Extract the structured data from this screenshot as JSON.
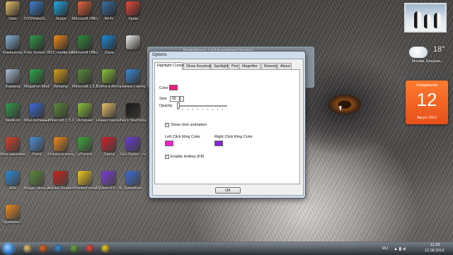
{
  "desktop_icons": [
    {
      "name": "desktop-icon-user",
      "icon": "folder-user-icon",
      "label": "User",
      "color": "#e8c26a"
    },
    {
      "name": "desktop-icon-dvdvideosoft",
      "icon": "dvdvideosoft-icon",
      "label": "DVDVideoS... Free Studio",
      "color": "#3a7fd0"
    },
    {
      "name": "desktop-icon-skype",
      "icon": "skype-icon",
      "label": "Skype",
      "color": "#1fa8e8"
    },
    {
      "name": "desktop-icon-ms-office-po",
      "icon": "office-powerpoint-icon",
      "label": "Microsoft Office Po...",
      "color": "#e8643a"
    },
    {
      "name": "desktop-icon-wifi",
      "icon": "wifi-icon",
      "label": "Wi-Fi",
      "color": "#3a6ea8"
    },
    {
      "name": "desktop-icon-chrome",
      "icon": "chrome-icon",
      "label": "Хром",
      "color": "#e84a3a"
    },
    {
      "name": "desktop-icon-computer",
      "icon": "computer-icon",
      "label": "Компьютер",
      "color": "#8ab4d8"
    },
    {
      "name": "desktop-icon-free-screen-video",
      "icon": "free-screen-video-icon",
      "label": "Free Screen Video Re...",
      "color": "#2f9a4a"
    },
    {
      "name": "desktop-icon-vlc",
      "icon": "vlc-icon",
      "label": "VLC media player",
      "color": "#f08a1a"
    },
    {
      "name": "desktop-icon-ms-office",
      "icon": "office-excel-icon",
      "label": "Microsoft Office",
      "color": "#2f8a3a"
    },
    {
      "name": "desktop-icon-zona",
      "icon": "zona-icon",
      "label": "Zona",
      "color": "#1a8ad8"
    },
    {
      "name": "desktop-icon-doc",
      "icon": "document-icon",
      "label": "",
      "color": "#f0f0f0"
    },
    {
      "name": "desktop-icon-recycle",
      "icon": "recycle-bin-icon",
      "label": "Корзина",
      "color": "#a8c0d8"
    },
    {
      "name": "desktop-icon-megafon",
      "icon": "megafon-icon",
      "label": "MegaFon Modem",
      "color": "#2fa84a"
    },
    {
      "name": "desktop-icon-winamp",
      "icon": "winamp-icon",
      "label": "Winamp",
      "color": "#d8a01a"
    },
    {
      "name": "desktop-icon-minecraft-1",
      "icon": "minecraft-icon",
      "label": "Minecraft 1.5.2 - Mine...",
      "color": "#5a8a3a"
    },
    {
      "name": "desktop-icon-vk",
      "icon": "vk-login-icon",
      "label": "Войти в Интернет",
      "color": "#8ac43a"
    },
    {
      "name": "desktop-icon-download",
      "icon": "download-icon",
      "label": "скачка с интернета...",
      "color": "#3a8ad8"
    },
    {
      "name": "desktop-icon-multifon",
      "icon": "multifon-icon",
      "label": "MultiFon",
      "color": "#2f9a4a"
    },
    {
      "name": "desktop-icon-my-games",
      "icon": "my-games-icon",
      "label": "Мои любимые...",
      "color": "#3a6ad8"
    },
    {
      "name": "desktop-icon-minecraft-2",
      "icon": "minecraft-icon",
      "label": "Minecraft 1.5.2 - Mine...",
      "color": "#5a8a3a"
    },
    {
      "name": "desktop-icon-internet",
      "icon": "internet-icon",
      "label": "Интернет",
      "color": "#8ac43a"
    },
    {
      "name": "desktop-icon-new-folder",
      "icon": "folder-icon",
      "label": "Новая сжатая ...",
      "color": "#e8c26a"
    },
    {
      "name": "desktop-icon-nero",
      "icon": "nero-icon",
      "label": "Nero StartSmart",
      "color": "#1a1a1a"
    },
    {
      "name": "desktop-icon-my-stickers",
      "icon": "stickers-icon",
      "label": "Мои наклейки",
      "color": "#d8402a"
    },
    {
      "name": "desktop-icon-paint",
      "icon": "paint-icon",
      "label": "Paint",
      "color": "#4a90d8"
    },
    {
      "name": "desktop-icon-mail-search",
      "icon": "mail-search-icon",
      "label": "Искать в интернете",
      "color": "#f08a1a"
    },
    {
      "name": "desktop-icon-utorrent",
      "icon": "utorrent-icon",
      "label": "µTorrent",
      "color": "#3aa83a"
    },
    {
      "name": "desktop-icon-opera",
      "icon": "opera-icon",
      "label": "Opera",
      "color": "#d8202a"
    },
    {
      "name": "desktop-icon-get-styles",
      "icon": "get-styles-icon",
      "label": "Get-Styles - темы для ...",
      "color": "#6a3ad8"
    },
    {
      "name": "desktop-icon-9dx",
      "icon": "dx-icon",
      "label": "9Dx",
      "color": "#2a8ad8"
    },
    {
      "name": "desktop-icon-mods",
      "icon": "mods-icon",
      "label": "Моды, читы для Minecraft",
      "color": "#5a8a3a"
    },
    {
      "name": "desktop-icon-adobe-reader",
      "icon": "adobe-reader-icon",
      "label": "Adobe Reader X",
      "color": "#c8201a"
    },
    {
      "name": "desktop-icon-pointerfocus",
      "icon": "pointerfocus-icon",
      "label": "PointerFocus",
      "color": "#f0c81a"
    },
    {
      "name": "desktop-icon-djview",
      "icon": "djview-icon",
      "label": "DjView-0.5 - Ярлык",
      "color": "#7a3ad8"
    },
    {
      "name": "desktop-icon-speedfan",
      "icon": "speedfan-icon",
      "label": "SpeedFan",
      "color": "#3a6ad8"
    },
    {
      "name": "desktop-icon-odnoklassniki",
      "icon": "odnoklassniki-icon",
      "label": "Одноклас...",
      "color": "#f08a1a"
    }
  ],
  "gadgets": {
    "weather": {
      "temp": "18°",
      "city": "Москва, Бачургаз..."
    },
    "calendar": {
      "weekday": "понедельник",
      "day": "12",
      "month": "Август 2013"
    }
  },
  "background_window": {
    "title": "PointerFocus 1.4 (Unregistered Version)"
  },
  "dialog": {
    "title": "Options",
    "tabs": [
      "Highlight Cursor",
      "Show Keystrokes",
      "Spotlight",
      "Pen",
      "Magnifier",
      "Remote",
      "About"
    ],
    "active_tab": 0,
    "color_label": "Color",
    "color_value": "#e8207a",
    "size_label": "Size",
    "size_value": "65",
    "opacity_label": "Opacity",
    "opacity_level": 0.0,
    "show_click_animation": {
      "label": "Show click animation",
      "checked": true
    },
    "left_ring": {
      "label": "Left Click Ring Color",
      "color": "#f020c8"
    },
    "right_ring": {
      "label": "Right Click Ring Color",
      "color": "#8a20e0"
    },
    "enable_hotkey": {
      "label": "Enable Hotkey (F8)",
      "checked": true
    },
    "ok_label": "OK"
  },
  "taskbar": {
    "buttons": [
      {
        "name": "taskbar-explorer",
        "icon": "explorer-icon",
        "color": "#e8c26a"
      },
      {
        "name": "taskbar-firefox",
        "icon": "firefox-icon",
        "color": "#e8641a"
      },
      {
        "name": "taskbar-mail",
        "icon": "mail-at-icon",
        "color": "#3a8ad8"
      },
      {
        "name": "taskbar-minecraft",
        "icon": "minecraft-icon",
        "color": "#6aa83a"
      },
      {
        "name": "taskbar-chrome",
        "icon": "chrome-icon",
        "color": "#e84a3a"
      },
      {
        "name": "taskbar-pointerfocus",
        "icon": "pointerfocus-icon",
        "color": "#f0c81a"
      }
    ],
    "lang": "RU",
    "time": "11:29",
    "date": "12.08.2013"
  }
}
